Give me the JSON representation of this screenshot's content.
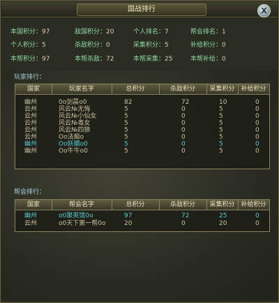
{
  "window": {
    "title": "国战排行",
    "close_label": "X"
  },
  "stats": [
    [
      {
        "k": "本国积分：",
        "v": "97"
      },
      {
        "k": "敌国积分：",
        "v": "20"
      },
      {
        "k": "个人排名：",
        "v": "7"
      },
      {
        "k": "帮会排名：",
        "v": "1"
      }
    ],
    [
      {
        "k": "个人积分：",
        "v": "5"
      },
      {
        "k": "杀敌积分：",
        "v": "0"
      },
      {
        "k": "采集积分：",
        "v": "5"
      },
      {
        "k": "补给积分：",
        "v": "0"
      }
    ],
    [
      {
        "k": "本帮积分：",
        "v": "97"
      },
      {
        "k": "本帮杀敌：",
        "v": "72"
      },
      {
        "k": "本帮采集：",
        "v": "25"
      },
      {
        "k": "本帮补给：",
        "v": "0"
      }
    ]
  ],
  "player_ranking": {
    "label": "玩家排行：",
    "columns": [
      "国家",
      "玩家名字",
      "总积分",
      "杀敌积分",
      "采集积分",
      "补给积分"
    ],
    "rows": [
      {
        "nation": "幽州",
        "name": "0o剑晨o0",
        "total": "82",
        "kill": "72",
        "gather": "10",
        "supply": "0",
        "hl": false
      },
      {
        "nation": "云州",
        "name": "风云№无悔",
        "total": "5",
        "kill": "0",
        "gather": "5",
        "supply": "0",
        "hl": false
      },
      {
        "nation": "云州",
        "name": "风云№小仙女",
        "total": "5",
        "kill": "0",
        "gather": "5",
        "supply": "0",
        "hl": false
      },
      {
        "nation": "云州",
        "name": "风云№毒女",
        "total": "5",
        "kill": "0",
        "gather": "5",
        "supply": "0",
        "hl": false
      },
      {
        "nation": "云州",
        "name": "风云№四狼",
        "total": "5",
        "kill": "0",
        "gather": "5",
        "supply": "0",
        "hl": false
      },
      {
        "nation": "云州",
        "name": "Oo法痴o",
        "total": "5",
        "kill": "0",
        "gather": "5",
        "supply": "0",
        "hl": false
      },
      {
        "nation": "幽州",
        "name": "Oo妖媚o0",
        "total": "5",
        "kill": "0",
        "gather": "5",
        "supply": "0",
        "hl": true
      },
      {
        "nation": "幽州",
        "name": "Oo牛牛o0",
        "total": "5",
        "kill": "0",
        "gather": "5",
        "supply": "0",
        "hl": false
      }
    ]
  },
  "guild_ranking": {
    "label": "帮会排行：",
    "columns": [
      "国家",
      "帮会名字",
      "总积分",
      "杀敌积分",
      "采集积分",
      "补给积分"
    ],
    "rows": [
      {
        "nation": "幽州",
        "name": "o0聚英馆0o",
        "total": "97",
        "kill": "72",
        "gather": "25",
        "supply": "0",
        "hl": true
      },
      {
        "nation": "云州",
        "name": "o0天下第一帮0o",
        "total": "20",
        "kill": "0",
        "gather": "20",
        "supply": "0",
        "hl": false
      }
    ]
  },
  "colors": {
    "label_green": "#8fd6a0",
    "highlight_cyan": "#5cc8d0",
    "border": "#8a8264"
  }
}
